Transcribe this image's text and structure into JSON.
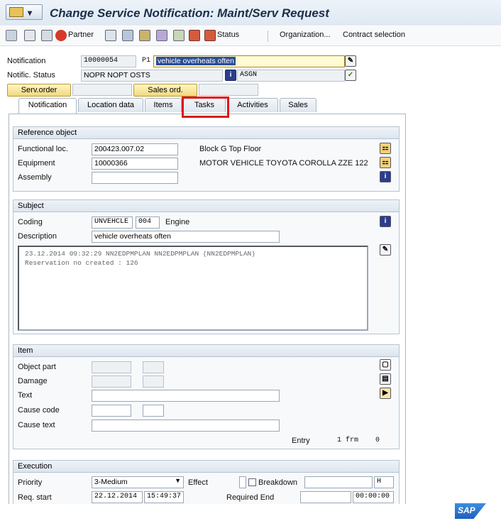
{
  "window": {
    "title": "Change Service Notification: Maint/Serv Request"
  },
  "toolbar": {
    "partner": "Partner",
    "status": "Status",
    "organization": "Organization...",
    "contract_selection": "Contract selection"
  },
  "header": {
    "notification_label": "Notification",
    "notification_number": "10000054",
    "notification_type": "P1",
    "notification_desc": "vehicle overheats often",
    "status_label": "Notific. Status",
    "status_value": "NOPR NOPT OSTS",
    "user_status": "ASGN",
    "serv_order_label": "Serv.order",
    "sales_ord_label": "Sales ord."
  },
  "tabs": [
    {
      "label": "Notification"
    },
    {
      "label": "Location data"
    },
    {
      "label": "Items"
    },
    {
      "label": "Tasks"
    },
    {
      "label": "Activities"
    },
    {
      "label": "Sales"
    }
  ],
  "reference": {
    "title": "Reference object",
    "func_loc_label": "Functional loc.",
    "func_loc_value": "200423.007.02",
    "func_loc_desc": "Block G Top Floor",
    "equipment_label": "Equipment",
    "equipment_value": "10000366",
    "equipment_desc": "MOTOR VEHICLE TOYOTA COROLLA ZZE 122",
    "assembly_label": "Assembly",
    "assembly_value": ""
  },
  "subject": {
    "title": "Subject",
    "coding_label": "Coding",
    "coding_group": "UNVEHCLE",
    "coding_code": "004",
    "coding_text": "Engine",
    "description_label": "Description",
    "description_value": "vehicle overheats often",
    "longtext_line1": "23.12.2014 09:32:29 NN2EDPMPLAN NN2EDPMPLAN (NN2EDPMPLAN)",
    "longtext_line2": "Reservation no created : 126"
  },
  "item": {
    "title": "Item",
    "object_part_label": "Object part",
    "damage_label": "Damage",
    "text_label": "Text",
    "cause_code_label": "Cause code",
    "cause_text_label": "Cause text",
    "entry_label": "Entry",
    "entry_value": "1 frm",
    "entry_count": "0"
  },
  "execution": {
    "title": "Execution",
    "priority_label": "Priority",
    "priority_value": "3-Medium",
    "effect_label": "Effect",
    "breakdown_label": "Breakdown",
    "unit_value": "H",
    "req_start_label": "Req. start",
    "req_start_date": "22.12.2014",
    "req_start_time": "15:49:37",
    "required_end_label": "Required End",
    "required_end_time": "00:00:00"
  },
  "brand": {
    "logo": "SAP"
  },
  "colors": {
    "highlight": "#e0151a",
    "accent": "#1a2f4a"
  }
}
